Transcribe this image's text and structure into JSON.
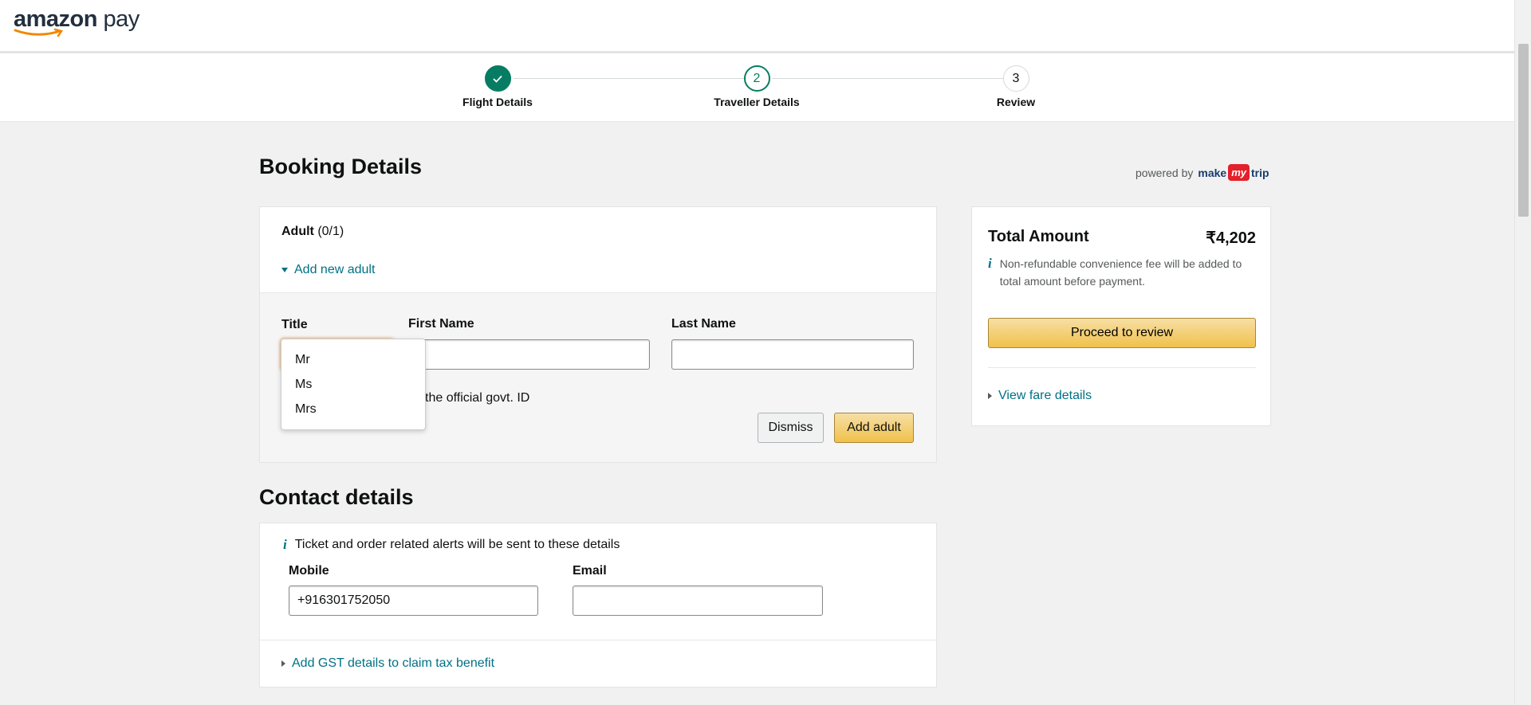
{
  "header": {
    "logo_amazon": "amazon",
    "logo_pay": " pay"
  },
  "stepper": {
    "steps": [
      {
        "number": "✓",
        "label": "Flight Details",
        "state": "done"
      },
      {
        "number": "2",
        "label": "Traveller Details",
        "state": "active"
      },
      {
        "number": "3",
        "label": "Review",
        "state": "todo"
      }
    ]
  },
  "page": {
    "title": "Booking Details"
  },
  "powered": {
    "text": "powered by",
    "brand_make": "make",
    "brand_my": "my",
    "brand_trip": "trip"
  },
  "adult": {
    "heading": "Adult",
    "count": "(0/1)",
    "add_new_label": "Add new adult",
    "title_label": "Title",
    "first_name_label": "First Name",
    "last_name_label": "Last Name",
    "id_note": "the official govt. ID",
    "dismiss_label": "Dismiss",
    "add_label": "Add adult"
  },
  "title_dropdown": {
    "options": [
      "Mr",
      "Ms",
      "Mrs"
    ]
  },
  "contact": {
    "section_title": "Contact details",
    "note_icon": "i",
    "note": "Ticket and order related alerts will be sent to these details",
    "mobile_label": "Mobile",
    "mobile_value": "+916301752050",
    "email_label": "Email",
    "email_value": "",
    "gst_label": "Add GST details to claim tax benefit"
  },
  "summary": {
    "total_label": "Total Amount",
    "total_value": "₹4,202",
    "fee_icon": "i",
    "fee_note": "Non-refundable convenience fee will be added to total amount before payment.",
    "proceed_label": "Proceed to review",
    "fare_link": "View fare details"
  },
  "colors": {
    "accent_link": "#007185",
    "success": "#067d62",
    "button_yellow": "#f0c14b"
  }
}
